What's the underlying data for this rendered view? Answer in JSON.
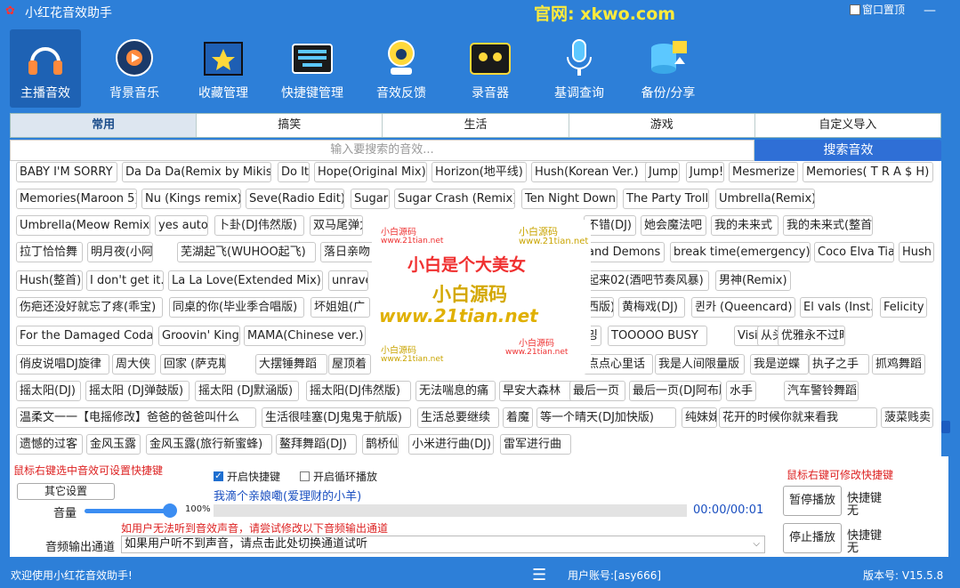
{
  "title_bar": {
    "app_title": "小红花音效助手",
    "website": "官网: xkwo.com",
    "pin_label": "窗口置顶",
    "minimize": "—",
    "maximize": "☐",
    "close": "✕"
  },
  "toolbar": [
    {
      "label": "主播音效",
      "icon": "headphones-icon"
    },
    {
      "label": "背景音乐",
      "icon": "music-disc-icon"
    },
    {
      "label": "收藏管理",
      "icon": "star-folder-icon"
    },
    {
      "label": "快捷键管理",
      "icon": "keyboard-icon"
    },
    {
      "label": "音效反馈",
      "icon": "feedback-icon"
    },
    {
      "label": "录音器",
      "icon": "cassette-icon"
    },
    {
      "label": "基调查询",
      "icon": "microphone-icon"
    },
    {
      "label": "备份/分享",
      "icon": "database-upload-icon"
    }
  ],
  "tabs": [
    "常用",
    "搞笑",
    "生活",
    "游戏",
    "自定义导入"
  ],
  "search": {
    "placeholder": "输入要搜索的音效...",
    "button": "搜索音效"
  },
  "sounds": [
    [
      "BABY I'M SORRY",
      "Da Da Da(Remix by Mikis)",
      "Do It",
      "Hope(Original Mix)",
      "Horizon(地平线)",
      "Hush(Korean Ver.)",
      "Jump",
      "Jump!",
      "Mesmerize",
      "Memories( T R A $ H)"
    ],
    [
      "Memories(Maroon 5)",
      "Nu (Kings remix)",
      "Seve(Radio Edit)",
      "Sugar",
      "Sugar Crash (Remix)",
      "Ten Night Down",
      "The Party Troll",
      "Umbrella(Remix)"
    ],
    [
      "Umbrella(Meow Remix)",
      "yes auto",
      "卜卦(DJ伟然版)",
      "双马尾弹力",
      "不错(DJ)",
      "她会魔法吧",
      "我的未来式",
      "我的未来式(整首)"
    ],
    [
      "拉丁恰恰舞",
      "明月夜(小阿枫)",
      "芜湖起飞(WUHOO起飞)",
      "落日亲吻",
      "and Demons",
      "break time(emergency)",
      "Coco Elva Tia",
      "Hush"
    ],
    [
      "Hush(整首)",
      "I don't get it.",
      "La La Love(Extended Mix)",
      "unrave",
      "起来02(酒吧节奏风暴)",
      "男神(Remix)"
    ],
    [
      "伤疤还没好就忘了疼(乖宝)",
      "同桌的你(毕业季合唱版)",
      "坏姐姐(广",
      "西版)",
      "黄梅戏(DJ)",
      "퀸카 (Queencard)",
      "El vals (Inst.)",
      "Felicity"
    ],
    [
      "For the Damaged Coda",
      "Groovin' King",
      "MAMA(Chinese ver.)",
      "밍",
      "TOOOOO BUSY",
      "Visions",
      "从头再来",
      "优雅永不过时"
    ],
    [
      "俏皮说唱DJ旋律",
      "周大侠",
      "回家 (萨克斯版)",
      "大摆锤舞蹈",
      "屋顶着",
      "点点心里话",
      "我是人间限量版",
      "我是逆蝶",
      "执子之手",
      "抓鸡舞蹈"
    ],
    [
      "摇太阳(DJ)",
      "摇太阳 (DJ弹鼓版)",
      "摇太阳 (DJ默涵版)",
      "摇太阳(DJ伟然版)",
      "无法喘息的痛",
      "早安大森林",
      "最后一页",
      "最后一页(DJ阿布版)",
      "水手",
      "汽车警铃舞蹈"
    ],
    [
      "温柔文一一【电摇修改】爸爸的爸爸叫什么",
      "生活很哇塞(DJ鬼鬼于航版)",
      "生活总要继续",
      "着魔",
      "等一个晴天(DJ加快版)",
      "纯妹妹",
      "花开的时候你就来看我",
      "菠菜贱卖"
    ],
    [
      "遗憾的过客",
      "金风玉露",
      "金风玉露(旅行新蜜蜂)",
      "鳌拜舞蹈(DJ)",
      "鹊桥仙",
      "小米进行曲(DJ)",
      "雷军进行曲"
    ]
  ],
  "watermark": {
    "big1": "小白是个大美女",
    "big2": "小白源码",
    "big3": "www.21tian.net",
    "small_a": "小白源码",
    "small_b": "www.21tian.net"
  },
  "bottom": {
    "hint_left": "鼠标右键选中音效可设置快捷键",
    "hint_right": "鼠标右键可修改快捷键",
    "other_settings": "其它设置",
    "enable_hotkey": "开启快捷键",
    "enable_loop": "开启循环播放",
    "now_playing": "我滴个亲娘嘞(爱理财的小羊)",
    "volume_label": "音量",
    "volume_value": "100%",
    "volume_level": 1.0,
    "time": "00:00/00:01",
    "audio_hint": "如用户无法听到音效声音，请尝试修改以下音频输出通道",
    "output_label": "音频输出通道",
    "output_select": "如果用户听不到声音，请点击此处切换通道试听",
    "pause": "暂停播放",
    "stop": "停止播放",
    "hotkey_label": "快捷键",
    "hotkey_value": "无"
  },
  "status": {
    "welcome": "欢迎使用小红花音效助手!",
    "account": "用户账号:[asy666]",
    "version": "版本号: V15.5.8"
  }
}
